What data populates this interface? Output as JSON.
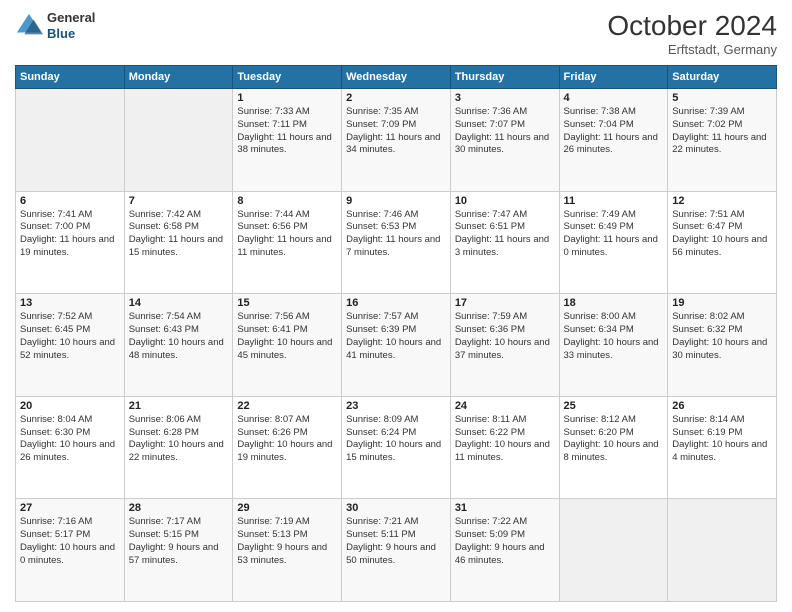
{
  "header": {
    "logo_line1": "General",
    "logo_line2": "Blue",
    "month": "October 2024",
    "location": "Erftstadt, Germany"
  },
  "days_of_week": [
    "Sunday",
    "Monday",
    "Tuesday",
    "Wednesday",
    "Thursday",
    "Friday",
    "Saturday"
  ],
  "weeks": [
    [
      {
        "day": "",
        "info": ""
      },
      {
        "day": "",
        "info": ""
      },
      {
        "day": "1",
        "info": "Sunrise: 7:33 AM\nSunset: 7:11 PM\nDaylight: 11 hours and 38 minutes."
      },
      {
        "day": "2",
        "info": "Sunrise: 7:35 AM\nSunset: 7:09 PM\nDaylight: 11 hours and 34 minutes."
      },
      {
        "day": "3",
        "info": "Sunrise: 7:36 AM\nSunset: 7:07 PM\nDaylight: 11 hours and 30 minutes."
      },
      {
        "day": "4",
        "info": "Sunrise: 7:38 AM\nSunset: 7:04 PM\nDaylight: 11 hours and 26 minutes."
      },
      {
        "day": "5",
        "info": "Sunrise: 7:39 AM\nSunset: 7:02 PM\nDaylight: 11 hours and 22 minutes."
      }
    ],
    [
      {
        "day": "6",
        "info": "Sunrise: 7:41 AM\nSunset: 7:00 PM\nDaylight: 11 hours and 19 minutes."
      },
      {
        "day": "7",
        "info": "Sunrise: 7:42 AM\nSunset: 6:58 PM\nDaylight: 11 hours and 15 minutes."
      },
      {
        "day": "8",
        "info": "Sunrise: 7:44 AM\nSunset: 6:56 PM\nDaylight: 11 hours and 11 minutes."
      },
      {
        "day": "9",
        "info": "Sunrise: 7:46 AM\nSunset: 6:53 PM\nDaylight: 11 hours and 7 minutes."
      },
      {
        "day": "10",
        "info": "Sunrise: 7:47 AM\nSunset: 6:51 PM\nDaylight: 11 hours and 3 minutes."
      },
      {
        "day": "11",
        "info": "Sunrise: 7:49 AM\nSunset: 6:49 PM\nDaylight: 11 hours and 0 minutes."
      },
      {
        "day": "12",
        "info": "Sunrise: 7:51 AM\nSunset: 6:47 PM\nDaylight: 10 hours and 56 minutes."
      }
    ],
    [
      {
        "day": "13",
        "info": "Sunrise: 7:52 AM\nSunset: 6:45 PM\nDaylight: 10 hours and 52 minutes."
      },
      {
        "day": "14",
        "info": "Sunrise: 7:54 AM\nSunset: 6:43 PM\nDaylight: 10 hours and 48 minutes."
      },
      {
        "day": "15",
        "info": "Sunrise: 7:56 AM\nSunset: 6:41 PM\nDaylight: 10 hours and 45 minutes."
      },
      {
        "day": "16",
        "info": "Sunrise: 7:57 AM\nSunset: 6:39 PM\nDaylight: 10 hours and 41 minutes."
      },
      {
        "day": "17",
        "info": "Sunrise: 7:59 AM\nSunset: 6:36 PM\nDaylight: 10 hours and 37 minutes."
      },
      {
        "day": "18",
        "info": "Sunrise: 8:00 AM\nSunset: 6:34 PM\nDaylight: 10 hours and 33 minutes."
      },
      {
        "day": "19",
        "info": "Sunrise: 8:02 AM\nSunset: 6:32 PM\nDaylight: 10 hours and 30 minutes."
      }
    ],
    [
      {
        "day": "20",
        "info": "Sunrise: 8:04 AM\nSunset: 6:30 PM\nDaylight: 10 hours and 26 minutes."
      },
      {
        "day": "21",
        "info": "Sunrise: 8:06 AM\nSunset: 6:28 PM\nDaylight: 10 hours and 22 minutes."
      },
      {
        "day": "22",
        "info": "Sunrise: 8:07 AM\nSunset: 6:26 PM\nDaylight: 10 hours and 19 minutes."
      },
      {
        "day": "23",
        "info": "Sunrise: 8:09 AM\nSunset: 6:24 PM\nDaylight: 10 hours and 15 minutes."
      },
      {
        "day": "24",
        "info": "Sunrise: 8:11 AM\nSunset: 6:22 PM\nDaylight: 10 hours and 11 minutes."
      },
      {
        "day": "25",
        "info": "Sunrise: 8:12 AM\nSunset: 6:20 PM\nDaylight: 10 hours and 8 minutes."
      },
      {
        "day": "26",
        "info": "Sunrise: 8:14 AM\nSunset: 6:19 PM\nDaylight: 10 hours and 4 minutes."
      }
    ],
    [
      {
        "day": "27",
        "info": "Sunrise: 7:16 AM\nSunset: 5:17 PM\nDaylight: 10 hours and 0 minutes."
      },
      {
        "day": "28",
        "info": "Sunrise: 7:17 AM\nSunset: 5:15 PM\nDaylight: 9 hours and 57 minutes."
      },
      {
        "day": "29",
        "info": "Sunrise: 7:19 AM\nSunset: 5:13 PM\nDaylight: 9 hours and 53 minutes."
      },
      {
        "day": "30",
        "info": "Sunrise: 7:21 AM\nSunset: 5:11 PM\nDaylight: 9 hours and 50 minutes."
      },
      {
        "day": "31",
        "info": "Sunrise: 7:22 AM\nSunset: 5:09 PM\nDaylight: 9 hours and 46 minutes."
      },
      {
        "day": "",
        "info": ""
      },
      {
        "day": "",
        "info": ""
      }
    ]
  ]
}
